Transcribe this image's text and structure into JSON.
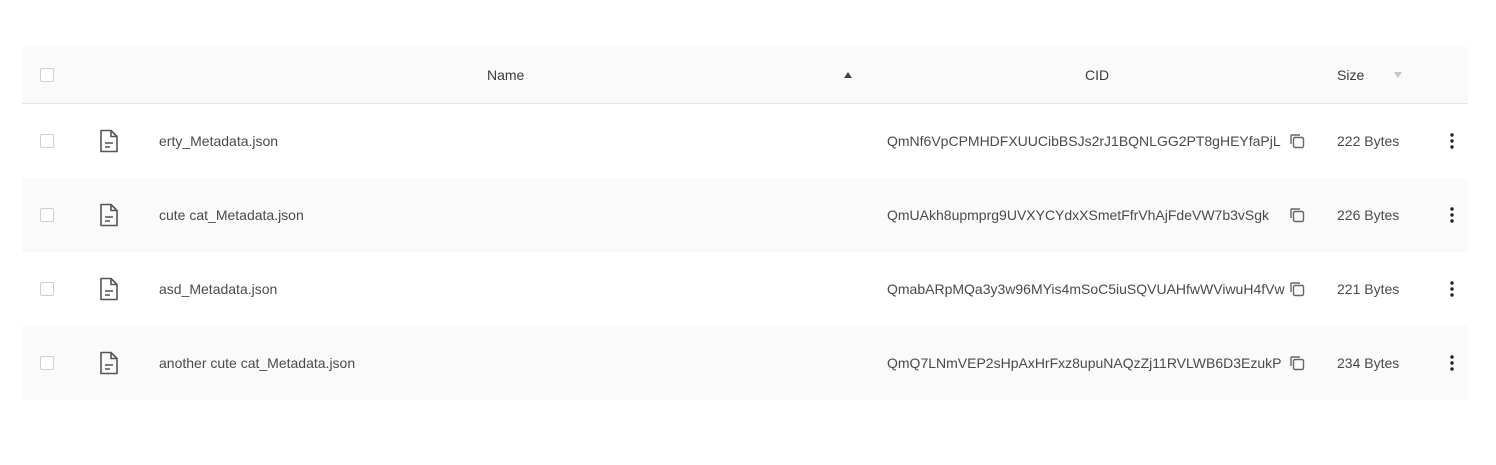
{
  "table": {
    "headers": {
      "name": "Name",
      "cid": "CID",
      "size": "Size"
    },
    "sort": {
      "name": "ascending",
      "size": "unsorted"
    },
    "rows": [
      {
        "name": "erty_Metadata.json",
        "cid": "QmNf6VpCPMHDFXUUCibBSJs2rJ1BQNLGG2PT8gHEYfaPjL",
        "size": "222 Bytes"
      },
      {
        "name": "cute cat_Metadata.json",
        "cid": "QmUAkh8upmprg9UVXYCYdxXSmetFfrVhAjFdeVW7b3vSgk",
        "size": "226 Bytes"
      },
      {
        "name": "asd_Metadata.json",
        "cid": "QmabARpMQa3y3w96MYis4mSoC5iuSQVUAHfwWViwuH4fVw",
        "size": "221 Bytes"
      },
      {
        "name": "another cute cat_Metadata.json",
        "cid": "QmQ7LNmVEP2sHpAxHrFxz8upuNAQzZj11RVLWB6D3EzukP",
        "size": "234 Bytes"
      }
    ]
  },
  "icons": {
    "file": "file-text-icon",
    "copy": "copy-icon",
    "menu": "kebab-menu-icon",
    "sort_up": "sort-ascending-icon",
    "sort_down": "sort-descending-icon"
  },
  "colors": {
    "header_bg": "#fafafa",
    "row_alt_bg": "#fafafa",
    "text": "#4a4a4a",
    "border": "#e4e4e4"
  }
}
